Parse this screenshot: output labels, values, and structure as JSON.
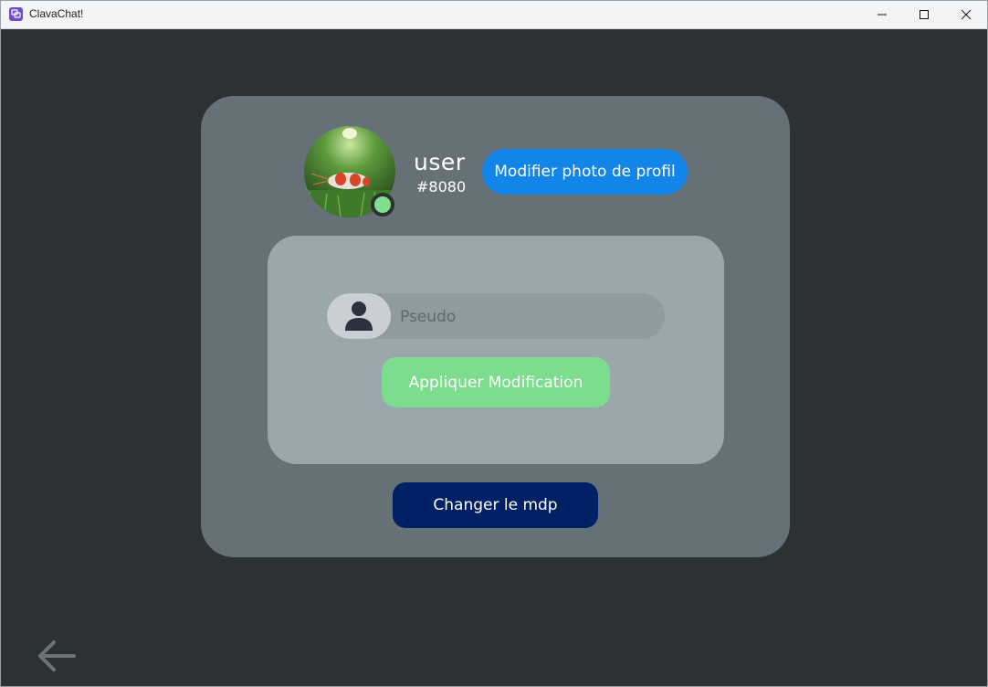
{
  "window": {
    "title": "ClavaChat!",
    "app_icon": "clavachat-logo-icon",
    "controls": [
      "minimize-icon",
      "maximize-icon",
      "close-icon"
    ]
  },
  "profile": {
    "username": "user",
    "tag": "#8080",
    "status_color": "#7fe08e",
    "change_photo_label": "Modifier photo de profil"
  },
  "form": {
    "pseudo_placeholder": "Pseudo",
    "pseudo_value": "",
    "input_icon": "user-icon",
    "apply_label": "Appliquer Modification"
  },
  "change_password_label": "Changer le mdp",
  "navigation": {
    "back_icon": "arrow-left-icon"
  },
  "colors": {
    "background": "#2c3134",
    "card": "#667177",
    "inner_panel": "#9aa8ae",
    "photo_button": "#1384e8",
    "apply_button": "#7cdd8e",
    "password_button": "#002066"
  }
}
